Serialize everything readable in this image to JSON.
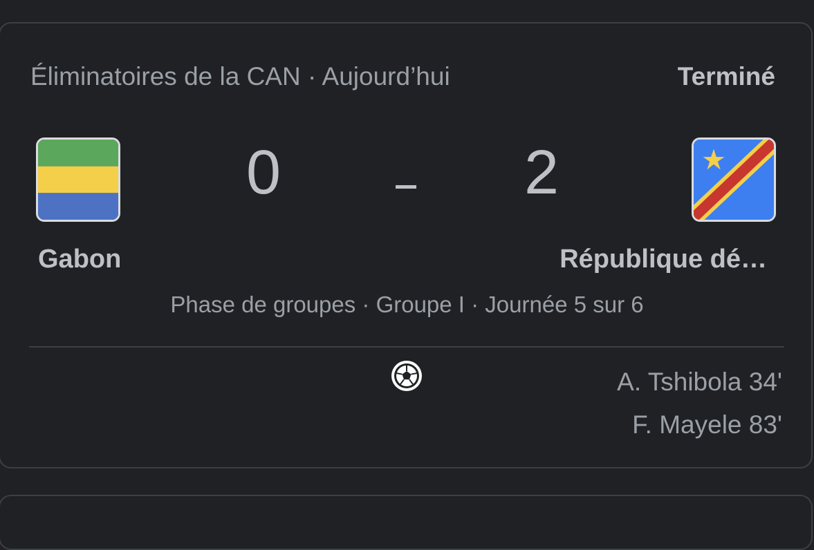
{
  "match": {
    "competition_line": "Éliminatoires de la CAN · Aujourd’hui",
    "status": "Terminé",
    "home": {
      "name": "Gabon",
      "score": "0",
      "flag_icon": "gabon-flag-icon",
      "flag_colors": [
        "#5ba85d",
        "#f4cf4a",
        "#4d72c4"
      ]
    },
    "away": {
      "name": "République dé…",
      "score": "2",
      "flag_icon": "dr-congo-flag-icon",
      "flag_colors": [
        "#3d7ff0",
        "#c7372f",
        "#f4cf4a"
      ]
    },
    "separator": "-",
    "phase": "Phase de groupes · Groupe I · Journée 5 sur 6",
    "goals_icon": "soccer-ball-icon",
    "away_scorers": [
      "A. Tshibola 34'",
      "F. Mayele 83'"
    ]
  }
}
